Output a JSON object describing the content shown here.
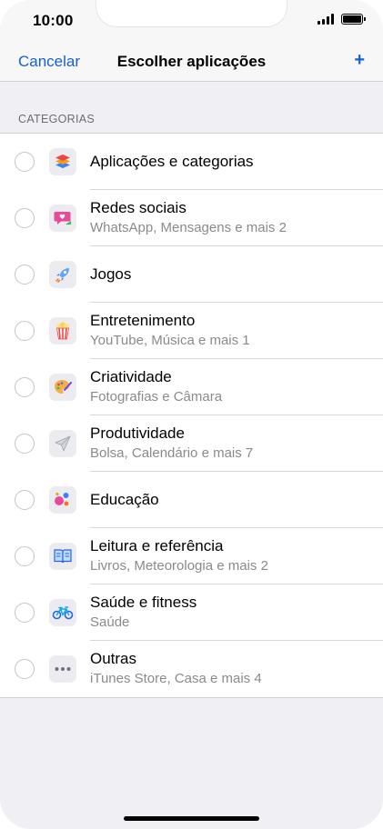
{
  "status": {
    "time": "10:00"
  },
  "nav": {
    "cancel_label": "Cancelar",
    "title": "Escolher aplicações",
    "add_label": "+"
  },
  "section": {
    "header": "CATEGORIAS"
  },
  "categories": [
    {
      "label": "Aplicações e categorias",
      "subtitle": "",
      "checked": true,
      "icon": "stack-icon"
    },
    {
      "label": "Redes sociais",
      "subtitle": "WhatsApp, Mensagens e mais 2",
      "checked": false,
      "icon": "chat-heart-icon"
    },
    {
      "label": "Jogos",
      "subtitle": "",
      "checked": false,
      "icon": "rocket-icon"
    },
    {
      "label": "Entretenimento",
      "subtitle": "YouTube, Música e mais 1",
      "checked": false,
      "icon": "popcorn-icon"
    },
    {
      "label": "Criatividade",
      "subtitle": "Fotografias e Câmara",
      "checked": false,
      "icon": "palette-icon"
    },
    {
      "label": "Produtividade",
      "subtitle": "Bolsa, Calendário e mais 7",
      "checked": false,
      "icon": "paper-plane-icon"
    },
    {
      "label": "Educação",
      "subtitle": "",
      "checked": false,
      "icon": "planet-icon"
    },
    {
      "label": "Leitura e referência",
      "subtitle": "Livros, Meteorologia e mais 2",
      "checked": false,
      "icon": "book-icon"
    },
    {
      "label": "Saúde e fitness",
      "subtitle": "Saúde",
      "checked": false,
      "icon": "bicycle-icon"
    },
    {
      "label": "Outras",
      "subtitle": "iTunes Store, Casa e mais 4",
      "checked": false,
      "icon": "ellipsis-icon"
    }
  ],
  "colors": {
    "accent": "#1a56d6",
    "link": "#1560d6",
    "background": "#efeff4"
  }
}
